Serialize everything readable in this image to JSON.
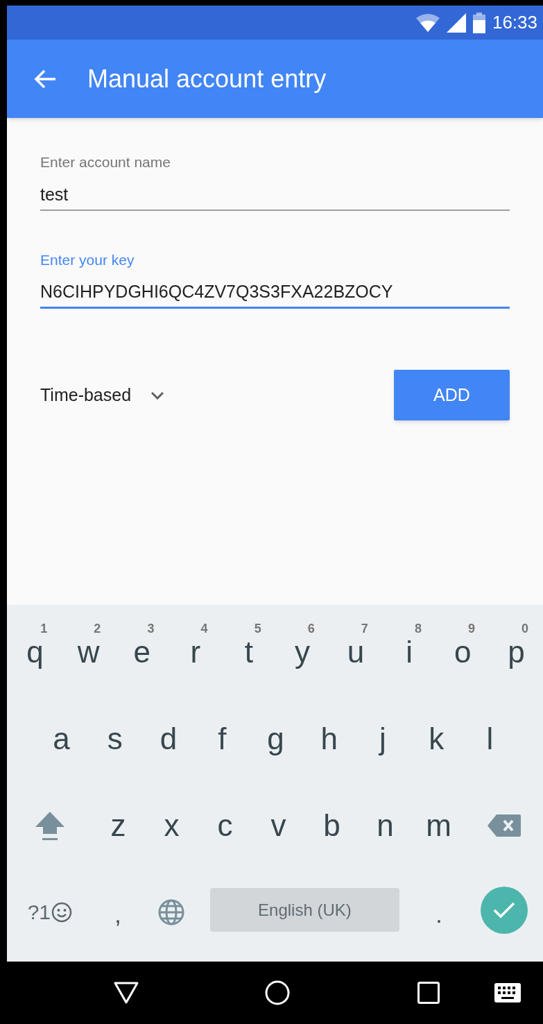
{
  "status_bar": {
    "time": "16:33"
  },
  "app_bar": {
    "title": "Manual account entry"
  },
  "fields": [
    {
      "label": "Enter account name",
      "value": "test",
      "focused": false
    },
    {
      "label": "Enter your key",
      "value": "N6CIHPYDGHI6QC4ZV7Q3S3FXA22BZOCY",
      "focused": true
    }
  ],
  "key_type": {
    "value": "Time-based"
  },
  "add_button": {
    "label": "ADD"
  },
  "keyboard": {
    "rows": [
      {
        "keys": [
          {
            "kind": "letter",
            "label": "q",
            "hint": "1"
          },
          {
            "kind": "letter",
            "label": "w",
            "hint": "2"
          },
          {
            "kind": "letter",
            "label": "e",
            "hint": "3"
          },
          {
            "kind": "letter",
            "label": "r",
            "hint": "4"
          },
          {
            "kind": "letter",
            "label": "t",
            "hint": "5"
          },
          {
            "kind": "letter",
            "label": "y",
            "hint": "6"
          },
          {
            "kind": "letter",
            "label": "u",
            "hint": "7"
          },
          {
            "kind": "letter",
            "label": "i",
            "hint": "8"
          },
          {
            "kind": "letter",
            "label": "o",
            "hint": "9"
          },
          {
            "kind": "letter",
            "label": "p",
            "hint": "0"
          }
        ]
      },
      {
        "keys": [
          {
            "kind": "letter",
            "label": "a"
          },
          {
            "kind": "letter",
            "label": "s"
          },
          {
            "kind": "letter",
            "label": "d"
          },
          {
            "kind": "letter",
            "label": "f"
          },
          {
            "kind": "letter",
            "label": "g"
          },
          {
            "kind": "letter",
            "label": "h"
          },
          {
            "kind": "letter",
            "label": "j"
          },
          {
            "kind": "letter",
            "label": "k"
          },
          {
            "kind": "letter",
            "label": "l"
          }
        ]
      },
      {
        "keys": [
          {
            "kind": "shift"
          },
          {
            "kind": "letter",
            "label": "z"
          },
          {
            "kind": "letter",
            "label": "x"
          },
          {
            "kind": "letter",
            "label": "c"
          },
          {
            "kind": "letter",
            "label": "v"
          },
          {
            "kind": "letter",
            "label": "b"
          },
          {
            "kind": "letter",
            "label": "n"
          },
          {
            "kind": "letter",
            "label": "m"
          },
          {
            "kind": "backspace"
          }
        ]
      },
      {
        "keys": [
          {
            "kind": "symbols",
            "label": "?1"
          },
          {
            "kind": "letter",
            "label": ","
          },
          {
            "kind": "globe"
          },
          {
            "kind": "space",
            "label": "English (UK)"
          },
          {
            "kind": "letter",
            "label": "."
          },
          {
            "kind": "enter"
          }
        ]
      }
    ]
  }
}
